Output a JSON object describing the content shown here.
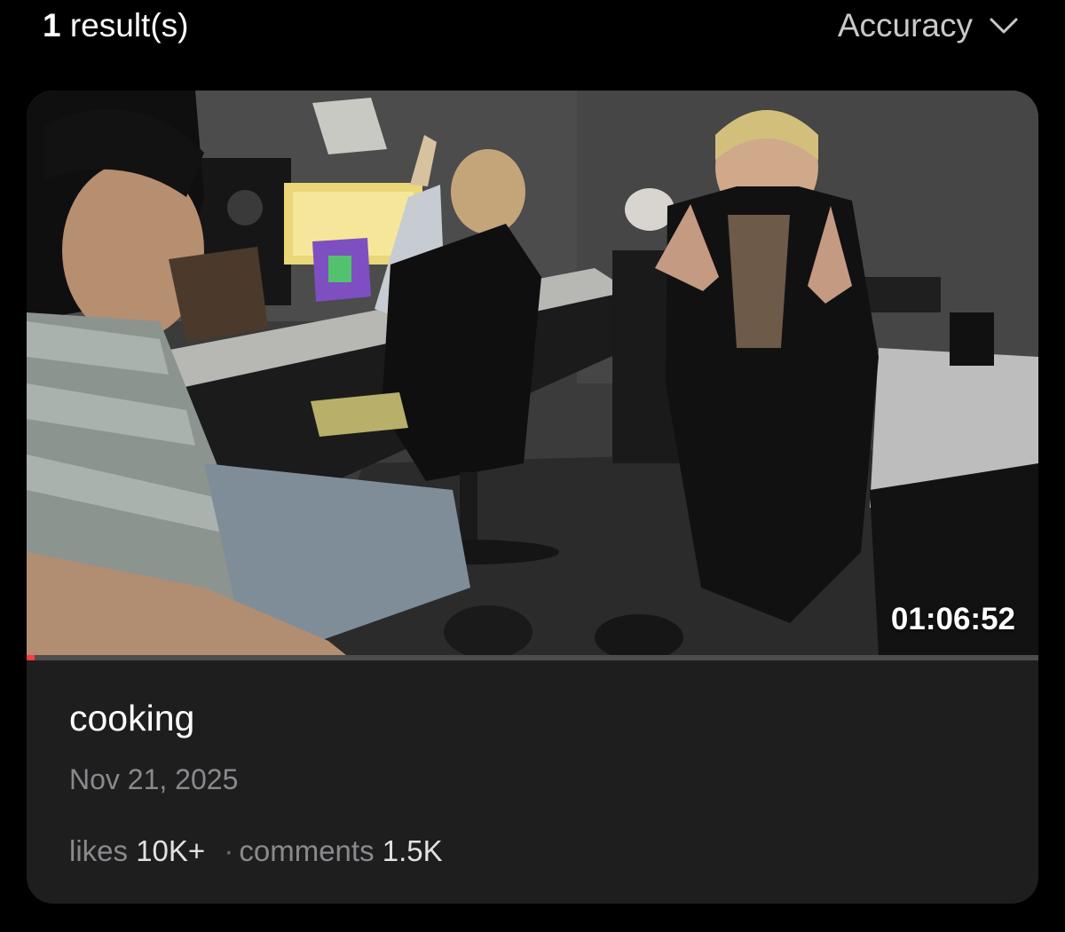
{
  "header": {
    "result_number": "1",
    "result_suffix": " result(s)",
    "sort_label": "Accuracy",
    "sort_icon": "chevron-down-icon"
  },
  "video": {
    "duration": "01:06:52",
    "watch_progress": 0.008,
    "title": "cooking",
    "date": "Nov 21, 2025",
    "likes_label": "likes",
    "likes_value": "10K+",
    "separator": "·",
    "comments_label": "comments",
    "comments_value": "1.5K"
  },
  "colors": {
    "background": "#000000",
    "card": "#1e1e1f",
    "secondary_text": "#8a8a8e",
    "progress_fill": "#ff3b3b",
    "progress_track": "#4d4d4e"
  }
}
